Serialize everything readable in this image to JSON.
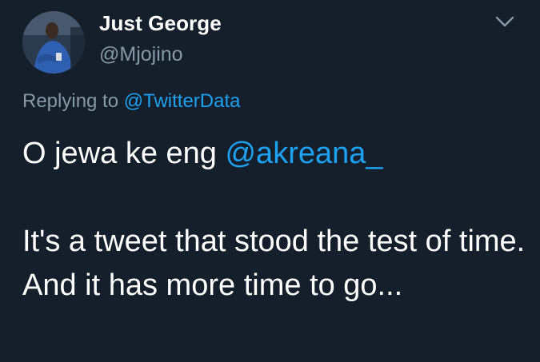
{
  "tweet": {
    "author": {
      "display_name": "Just George",
      "handle": "@Mjojino"
    },
    "reply": {
      "prefix": "Replying to ",
      "mention": "@TwitterData"
    },
    "text": {
      "line1_prefix": "O jewa ke eng ",
      "mention": "@akreana_",
      "paragraph2": "It's a tweet that stood the test of time. And it has more time to go..."
    }
  },
  "colors": {
    "background": "#151f2b",
    "text": "#ffffff",
    "secondary": "#8899a6",
    "accent": "#1da1f2"
  },
  "icons": {
    "menu": "chevron-down-icon",
    "avatar": "avatar"
  }
}
